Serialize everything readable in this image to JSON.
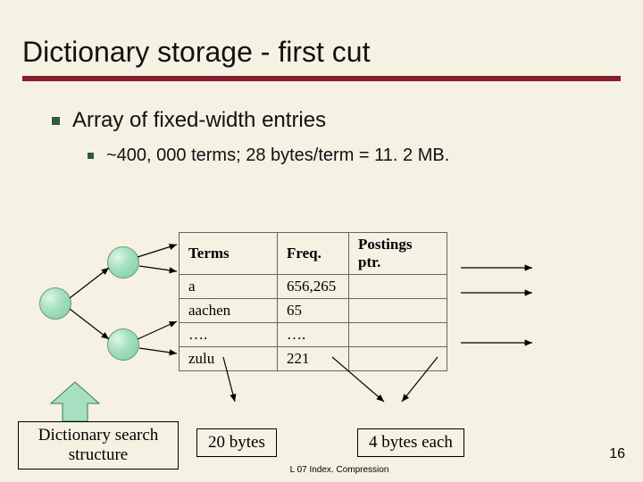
{
  "title": "Dictionary storage - first cut",
  "bullets": {
    "b1": "Array of fixed-width entries",
    "b2": "~400, 000 terms; 28 bytes/term = 11. 2 MB."
  },
  "table": {
    "headers": [
      "Terms",
      "Freq.",
      "Postings ptr."
    ],
    "rows": [
      [
        "a",
        "656,265",
        ""
      ],
      [
        "aachen",
        "65",
        ""
      ],
      [
        "….",
        "….",
        ""
      ],
      [
        "zulu",
        "221",
        ""
      ]
    ]
  },
  "dict_label": "Dictionary search\nstructure",
  "bytes20": "20 bytes",
  "bytes4": "4 bytes each",
  "footer": "L 07 Index. Compression",
  "pagenum": "16"
}
